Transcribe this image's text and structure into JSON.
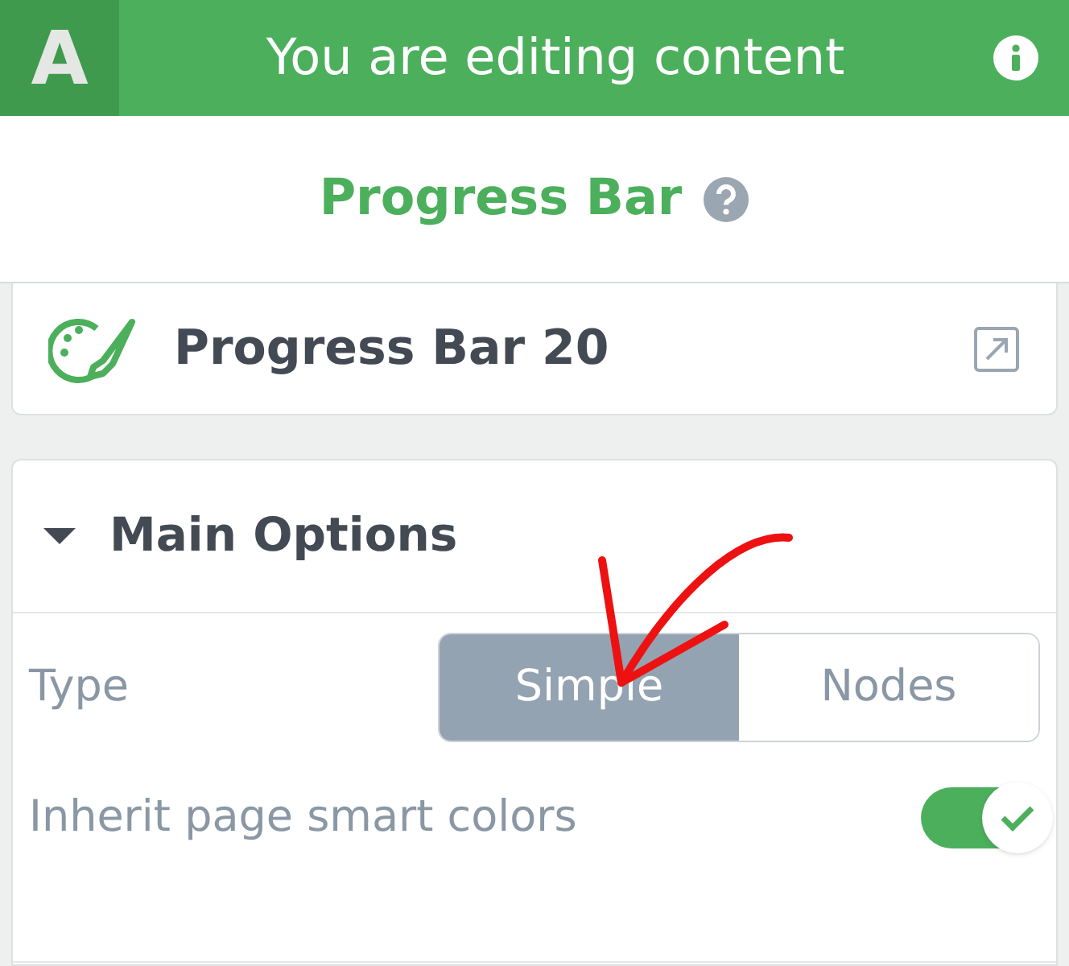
{
  "header": {
    "logo_text": "A",
    "title": "You are editing content"
  },
  "element": {
    "title": "Progress Bar",
    "instance": "Progress Bar 20"
  },
  "section": {
    "title": "Main Options",
    "expanded": true,
    "type": {
      "label": "Type",
      "options": [
        {
          "label": "Simple",
          "selected": true
        },
        {
          "label": "Nodes",
          "selected": false
        }
      ]
    },
    "inherit": {
      "label": "Inherit page smart colors",
      "on": true
    }
  }
}
